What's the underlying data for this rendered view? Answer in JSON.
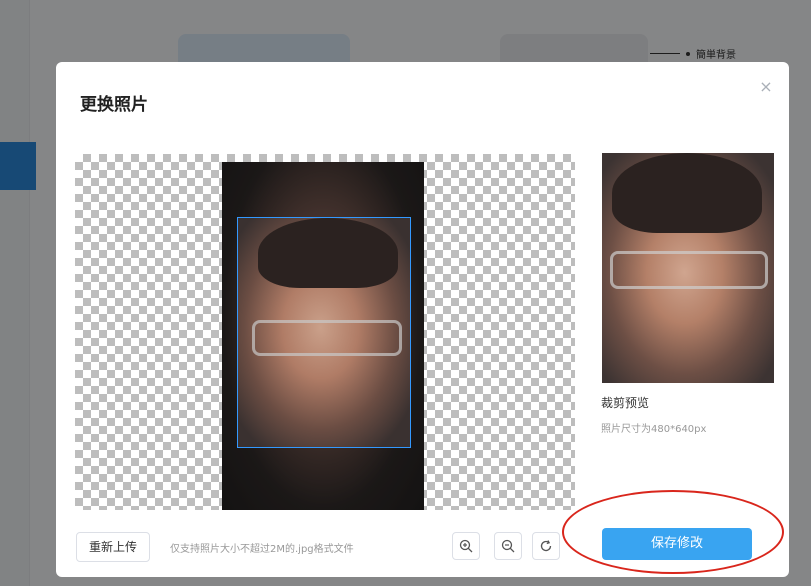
{
  "background": {
    "legend_label": "簡単背景"
  },
  "dialog": {
    "title": "更换照片",
    "close_glyph": "×"
  },
  "preview": {
    "title": "裁剪预览",
    "size_text": "照片尺寸为480*640px"
  },
  "footer": {
    "reupload_label": "重新上传",
    "hint_text": "仅支持照片大小不超过2M的.jpg格式文件",
    "save_label": "保存修改"
  },
  "tools": [
    {
      "icon": "zoom-in-icon"
    },
    {
      "icon": "zoom-out-icon"
    },
    {
      "icon": "rotate-icon"
    }
  ],
  "colors": {
    "accent": "#39a4f1",
    "annotation": "#d9261c",
    "crop_border": "#3399ff"
  }
}
